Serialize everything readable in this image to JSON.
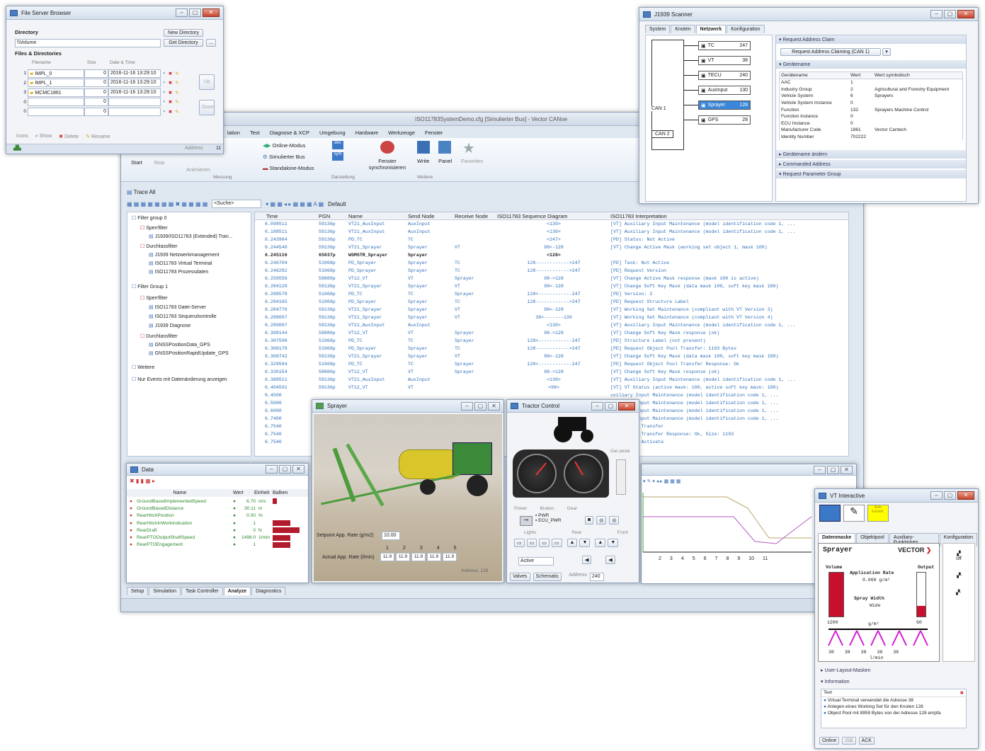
{
  "main": {
    "title": "ISO11783SystemDemo.cfg [Simulierter Bus] - Vector CANoe",
    "ribbon_tabs": [
      "lation",
      "Test",
      "Diagnose & XCP",
      "Umgebung",
      "Hardware",
      "Werkzeuge",
      "Fenster"
    ],
    "ribbon": {
      "start": "Start",
      "stop": "Stop",
      "animate": "Animieren",
      "group_measure": "Messung",
      "online": "Online-Modus",
      "simbus": "Simulierter Bus",
      "standalone": "Standalone-Modus",
      "group_display": "Darstellung",
      "fenster_sync": "Fenster synchronisieren",
      "write": "Write",
      "panel": "Panel",
      "favorites": "Favoriten",
      "group_more": "Weitere"
    },
    "trace_title": "Trace All",
    "search_placeholder": "<Suche>",
    "default_label": "Default",
    "filter_groups": [
      {
        "label": "Filter group 0"
      },
      {
        "label": "Sperrfilter"
      },
      {
        "label": "J1939/ISO11783 (Extended) Tran..."
      },
      {
        "label": "Durchlassfilter"
      },
      {
        "label": "J1939 Netzwerkmanagement"
      },
      {
        "label": "ISO11783 Virtual Terminal"
      },
      {
        "label": "ISO11783 Prozessdaten"
      },
      {
        "label": "Filter Group 1"
      },
      {
        "label": "Sperrfilter"
      },
      {
        "label": "ISO11783 Datei-Server"
      },
      {
        "label": "ISO11783 Sequenzkontrolle"
      },
      {
        "label": "J1939 Diagnose"
      },
      {
        "label": "Durchlassfilter"
      },
      {
        "label": "GNSSPositionData_GPS"
      },
      {
        "label": "GNSSPositionRapidUpdate_GPS"
      },
      {
        "label": "Weitere"
      },
      {
        "label": "Nur Events mit Datenänderung anzeigen"
      }
    ],
    "trace_columns": [
      "Time",
      "PGN",
      "Name",
      "Send Node",
      "Receive Node",
      "ISO11783 Sequence Diagram",
      "ISO11783 Interpretation"
    ],
    "trace_rows": [
      [
        "6.098511",
        "59136p",
        "VT21_AuxInput",
        "AuxInput",
        "",
        "<130>",
        "[VT] Auxiliary Input Maintenance (model identification code 1, ..."
      ],
      [
        "6.188511",
        "59136p",
        "VT21_AuxInput",
        "AuxInput",
        "",
        "<130>",
        "[VT] Auxiliary Input Maintenance (model identification code 1, ..."
      ],
      [
        "6.243984",
        "59136p",
        "PD_TC",
        "TC",
        "",
        "<247>",
        "[PD] Status: Not Active"
      ],
      [
        "6.244540",
        "59136p",
        "VT21_Sprayer",
        "Sprayer",
        "VT",
        "98<-128",
        "[VT] Change Active Mask (working set object 1, mask 100)"
      ],
      [
        "6.245116",
        "65037p",
        "WSMSTR_Sprayer",
        "Sprayer",
        "",
        "<128>",
        ""
      ],
      [
        "6.246704",
        "51968p",
        "PD_Sprayer",
        "Sprayer",
        "TC",
        "128------------>247",
        "[PD] Task: Not Active"
      ],
      [
        "6.246282",
        "51968p",
        "PD_Sprayer",
        "Sprayer",
        "TC",
        "128------------>247",
        "[PD] Request Version"
      ],
      [
        "6.258556",
        "58880p",
        "VT12_VT",
        "VT",
        "Sprayer",
        "98->128",
        "[VT] Change Active Mask response (mask 100 is active)"
      ],
      [
        "6.284120",
        "59136p",
        "VT21_Sprayer",
        "Sprayer",
        "VT",
        "98<-128",
        "[VT] Change Soft Key Mask (data mask 100, soft key mask 180)"
      ],
      [
        "6.288578",
        "51968p",
        "PD_TC",
        "TC",
        "Sprayer",
        "128<------------247",
        "[PD] Version: 2"
      ],
      [
        "6.284165",
        "51968p",
        "PD_Sprayer",
        "Sprayer",
        "TC",
        "128------------>247",
        "[PD] Request Structure Label"
      ],
      [
        "6.284776",
        "59136p",
        "VT21_Sprayer",
        "Sprayer",
        "VT",
        "98<-128",
        "[VT] Working Set Maintenance (compliant with VT Version 3)"
      ],
      [
        "6.288007",
        "59136p",
        "VT21_Sprayer",
        "Sprayer",
        "VT",
        "38<-------130",
        "[VT] Working Set Maintenance (compliant with VT Version 4)"
      ],
      [
        "6.289087",
        "59136p",
        "VT21_AuxInput",
        "AuxInput",
        "",
        "<130>",
        "[VT] Auxiliary Input Maintenance (model identification code 1, ..."
      ],
      [
        "6.308144",
        "58880p",
        "VT12_VT",
        "VT",
        "Sprayer",
        "98->128",
        "[VT] Change Soft Key Mask response (ok)"
      ],
      [
        "6.307598",
        "51968p",
        "PD_TC",
        "TC",
        "Sprayer",
        "128<------------247",
        "[PD] Structure Label (not present)"
      ],
      [
        "6.308178",
        "51968p",
        "PD_Sprayer",
        "Sprayer",
        "TC",
        "128------------>247",
        "[PD] Request Object Pool Transfer: 1193 Bytes"
      ],
      [
        "6.308742",
        "59136p",
        "VT21_Sprayer",
        "Sprayer",
        "VT",
        "98<-128",
        "[VT] Change Soft Key Mask (data mask 100, soft key mask 180)"
      ],
      [
        "6.329594",
        "51968p",
        "PD_TC",
        "TC",
        "Sprayer",
        "128<------------247",
        "[PD] Request Object Pool Transfer Response: Ok"
      ],
      [
        "6.330154",
        "58880p",
        "VT12_VT",
        "VT",
        "Sprayer",
        "98->128",
        "[VT] Change Soft Key Mask response (ok)"
      ],
      [
        "6.388511",
        "59136p",
        "VT21_AuxInput",
        "AuxInput",
        "",
        "<130>",
        "[VT] Auxiliary Input Maintenance (model identification code 1, ..."
      ],
      [
        "6.404591",
        "59136p",
        "VT12_VT",
        "VT",
        "",
        "<98>",
        "[VT] VT Status (active mask: 100, active soft key mask: 180)"
      ],
      [
        "6.4500",
        "",
        "",
        "",
        "",
        "",
        "uxiliary Input Maintenance (model identification code 1, ..."
      ],
      [
        "6.5000",
        "",
        "",
        "",
        "",
        "",
        "uxiliary Input Maintenance (model identification code 1, ..."
      ],
      [
        "6.6000",
        "",
        "",
        "",
        "",
        "",
        "uxiliary Input Maintenance (model identification code 1, ..."
      ],
      [
        "6.7400",
        "",
        "",
        "",
        "",
        "",
        "uxiliary Input Maintenance (model identification code 1, ..."
      ],
      [
        "6.7540",
        "",
        "",
        "",
        "",
        "",
        "bject Pool Transfer"
      ],
      [
        "6.7540",
        "",
        "",
        "",
        "",
        "",
        "bject Pool Transfer Response: Ok, Size: 1193"
      ],
      [
        "6.7540",
        "",
        "",
        "",
        "",
        "",
        "bject Pool Activate"
      ]
    ],
    "bottom_tabs": [
      "Setup",
      "Simulation",
      "Task Controller",
      "Analyze",
      "Diagnostics"
    ]
  },
  "fsb": {
    "title": "File Server Browser",
    "directory_label": "Directory",
    "directory_value": "\\\\Volume",
    "new_dir": "New Directory",
    "get_dir": "Get Directory",
    "files_label": "Files & Directories",
    "cols": [
      "Filename",
      "Size",
      "Date & Time"
    ],
    "rows": [
      {
        "n": "1",
        "name": "IMPL_0",
        "size": "0",
        "date": "2016-11-16 13:29:10"
      },
      {
        "n": "2",
        "name": "IMPL_1",
        "size": "0",
        "date": "2016-11-16 13:29:10"
      },
      {
        "n": "3",
        "name": "MCMC1861",
        "size": "0",
        "date": "2016-11-16 13:29:10"
      },
      {
        "n": "0",
        "name": "",
        "size": "0",
        "date": ""
      },
      {
        "n": "0",
        "name": "",
        "size": "0",
        "date": ""
      }
    ],
    "up": "Up",
    "down": "Down",
    "icons_label": "Icons",
    "show": "Show",
    "delete": "Delete",
    "rename": "Rename",
    "address_label": "Address",
    "address_value": "11"
  },
  "j1939": {
    "title": "J1939 Scanner",
    "tabs": [
      "System",
      "Knoten",
      "Netzwerk",
      "Konfiguration"
    ],
    "nodes": [
      {
        "name": "TC",
        "addr": "247"
      },
      {
        "name": "VT",
        "addr": "38"
      },
      {
        "name": "TECU",
        "addr": "240"
      },
      {
        "name": "AuxInput",
        "addr": "130"
      },
      {
        "name": "Sprayer",
        "addr": "128"
      },
      {
        "name": "GPS",
        "addr": "28"
      }
    ],
    "can1": "CAN 1",
    "can2": "CAN 2",
    "sec_request": "Request Address Claim",
    "request_btn": "Request Address Claiming (CAN 1)",
    "sec_name": "Gerätename",
    "name_cols": [
      "Gerätename",
      "Wert",
      "Wert symbolisch"
    ],
    "name_rows": [
      [
        "AAC",
        "1",
        ""
      ],
      [
        "Industry Group",
        "2",
        "Agricultural and Forestry Equipment"
      ],
      [
        "Vehicle System",
        "6",
        "Sprayers"
      ],
      [
        "Vehicle System Instance",
        "0",
        ""
      ],
      [
        "Function",
        "132",
        "Sprayers Machine Control"
      ],
      [
        "Function Instance",
        "0",
        ""
      ],
      [
        "ECU Instance",
        "0",
        ""
      ],
      [
        "Manufacturer Code",
        "1861",
        "Vector Cantech"
      ],
      [
        "Identity Number",
        "702222",
        ""
      ]
    ],
    "sec_change": "Gerätename ändern",
    "sec_commanded": "Commanded Address",
    "sec_param": "Request Parameter Group"
  },
  "data": {
    "title": "Data",
    "cols": [
      "Name",
      "Wert",
      "Einheit",
      "Balken"
    ],
    "rows": [
      {
        "name": "GroundBasedImplementedSpeed",
        "value": "6.70",
        "unit": "m/s",
        "bar": 0.15
      },
      {
        "name": "GroundBasedDistance",
        "value": "30.11",
        "unit": "m",
        "bar": 0
      },
      {
        "name": "RearHitchPosition",
        "value": "0.00",
        "unit": "%",
        "bar": 0
      },
      {
        "name": "RearHitchInWorkIndication",
        "value": "1",
        "unit": "",
        "bar": 0.6
      },
      {
        "name": "RearDraft",
        "value": "0",
        "unit": "N",
        "bar": 0.9
      },
      {
        "name": "RearPTOOutputShaftSpeed",
        "value": "1498.0",
        "unit": "1/min",
        "bar": 0.6
      },
      {
        "name": "RearPTOEngagement",
        "value": "1",
        "unit": "",
        "bar": 0.6
      }
    ]
  },
  "sprayer": {
    "title": "Sprayer",
    "setpoint_label": "Setpoint App. Rate (g/m2)",
    "setpoint_value": "10.00",
    "sections": [
      "1",
      "2",
      "3",
      "4",
      "5"
    ],
    "actual_label": "Actual App. Rate (l/min)",
    "actual_values": [
      "11.9",
      "11.9",
      "11.9",
      "11.9",
      "11.9"
    ],
    "address": "Address: 128"
  },
  "tractor": {
    "title": "Tractor Control",
    "gas": "Gas pedal",
    "power": "Power",
    "brakes": "Brakes",
    "gear": "Gear",
    "pwr": "PWR",
    "ecu": "ECU_PWR",
    "lights": "Lights",
    "rear": "Rear",
    "front": "Front",
    "active": "Active",
    "valves": "Valves",
    "schematic": "Schematic",
    "address": "Address",
    "addr_value": "240"
  },
  "vt": {
    "title": "VT Interactive",
    "soft_yellow": "Auto Einstell.",
    "tabs": [
      "Datenmaske",
      "Objektpool",
      "Auxiliary-Funktionen",
      "Konfiguration"
    ],
    "sprayer": "Sprayer",
    "vector": "VECTOR",
    "volume": "Volume",
    "output": "Output",
    "app_rate": "Application Rate",
    "app_val": "0.060 g/m²",
    "spray_width": "Spray Width",
    "wide": "Wide",
    "v1200": "1200",
    "g_m2": "g/m²",
    "v60": "60",
    "nozzle_vals": [
      "38",
      "38",
      "38",
      "38",
      "38"
    ],
    "lmin": "l/min",
    "off": "off",
    "sec_layout": "User-Layout-Masken",
    "sec_info": "Information",
    "text_hdr": "Text",
    "messages": [
      "Virtual Terminal verwendet die Adresse 38",
      "Anlegen eines Working Set für den Knoten 128",
      "Object Pool mit 8959 Bytes von der Adresse 128 empfa"
    ],
    "online": "Online",
    "iso": "ISB",
    "ack": "ACK"
  },
  "graph": {
    "ticks": [
      "2",
      "3",
      "4",
      "5",
      "6",
      "7",
      "8",
      "9",
      "10",
      "11"
    ]
  }
}
